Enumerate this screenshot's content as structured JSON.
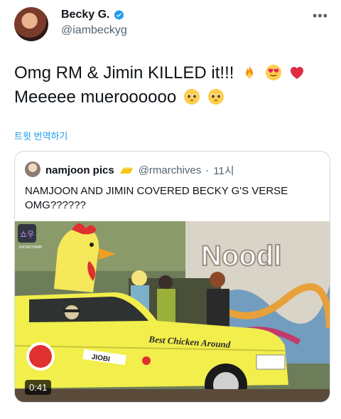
{
  "author": {
    "display_name": "Becky G.",
    "handle": "@iambeckyg",
    "more_label": "•••"
  },
  "tweet": {
    "line1": "Omg RM & Jimin KILLED it!!!",
    "line2": "Meeeee mueroooooo",
    "emojis_line1": [
      "fire-emoji",
      "heart-eyes-emoji",
      "red-heart-emoji"
    ],
    "emojis_line2": [
      "pleading-face-emoji",
      "pleading-face-emoji"
    ]
  },
  "translate_label": "트윗 번역하기",
  "quote": {
    "display_name": "namjoon pics",
    "handle": "@rmarchives",
    "separator": "·",
    "time": "11시",
    "text": "NAMJOON AND JIMIN COVERED BECKY G'S VERSE OMG??????",
    "video": {
      "duration": "0:41",
      "sign_text": "Noodl",
      "car_text": "Best Chicken Around",
      "sticker_text": "JIOBI",
      "channel_badge": "쇼우",
      "channel_sub": "SHOWCHAMP"
    }
  },
  "colors": {
    "accent": "#1d9bf0",
    "secondary_text": "#536471",
    "border": "#cfd9de",
    "taxi_yellow": "#f2ee4c"
  }
}
